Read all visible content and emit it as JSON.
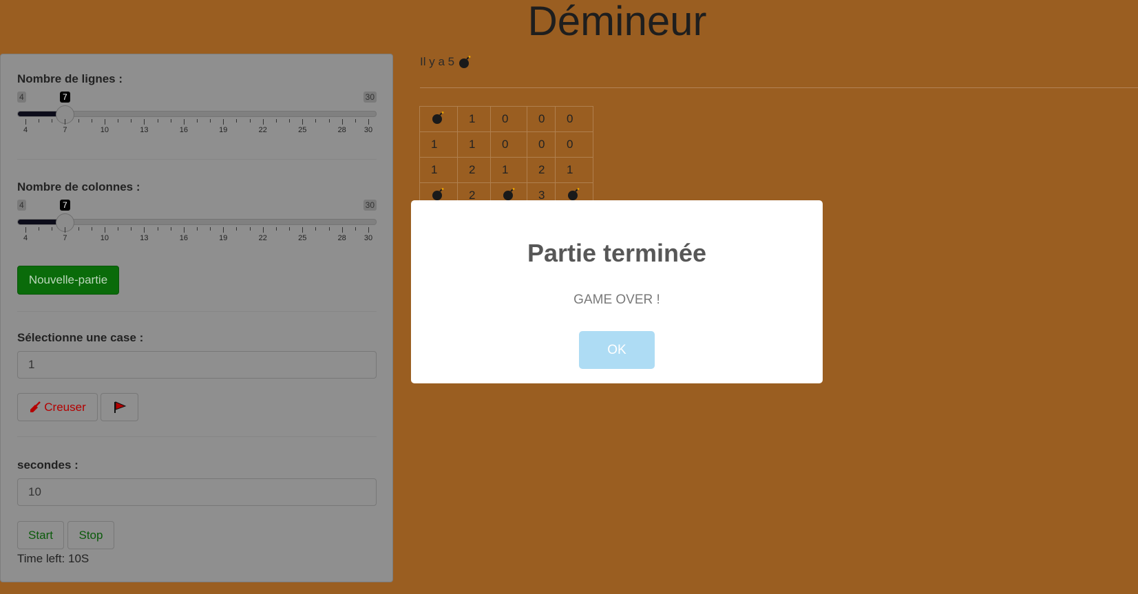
{
  "title": "Démineur",
  "sidebar": {
    "rows_label": "Nombre de lignes :",
    "rows_slider": {
      "min": "4",
      "max": "30",
      "value": "7",
      "ticks": [
        "4",
        "7",
        "10",
        "13",
        "16",
        "19",
        "22",
        "25",
        "28",
        "30"
      ]
    },
    "cols_label": "Nombre de colonnes :",
    "cols_slider": {
      "min": "4",
      "max": "30",
      "value": "7",
      "ticks": [
        "4",
        "7",
        "10",
        "13",
        "16",
        "19",
        "22",
        "25",
        "28",
        "30"
      ]
    },
    "new_game_label": "Nouvelle-partie",
    "select_label": "Sélectionne une case :",
    "select_value": "1",
    "dig_label": "Creuser",
    "seconds_label": "secondes :",
    "seconds_value": "10",
    "start_label": "Start",
    "stop_label": "Stop",
    "time_left": "Time left: 10S"
  },
  "main": {
    "bomb_count_text": "Il y a 5",
    "board": [
      [
        "bomb",
        "1",
        "0",
        "0",
        "0"
      ],
      [
        "1",
        "1",
        "0",
        "0",
        "0"
      ],
      [
        "1",
        "2",
        "1",
        "2",
        "1"
      ],
      [
        "bomb",
        "2",
        "bomb",
        "3",
        "bomb"
      ]
    ]
  },
  "modal": {
    "title": "Partie terminée",
    "message": "GAME OVER !",
    "ok_label": "OK"
  },
  "colors": {
    "background": "#9a5e21",
    "new_game_button": "#0a6b0a",
    "dig_red": "#b30000",
    "ok_button": "#aedcf4"
  }
}
